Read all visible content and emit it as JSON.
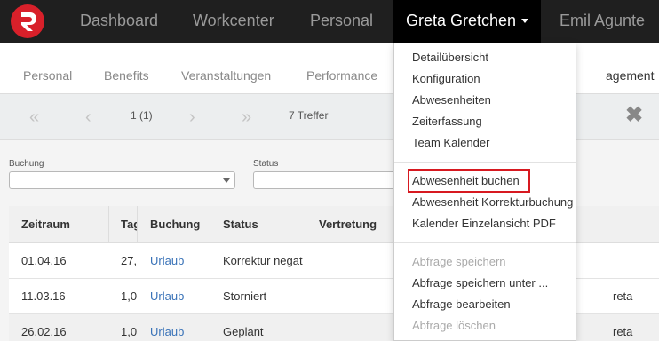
{
  "topnav": {
    "items": [
      "Dashboard",
      "Workcenter",
      "Personal"
    ],
    "active": "Greta Gretchen",
    "overflow": "Emil Agunte"
  },
  "subnav": {
    "items": [
      "Personal",
      "Benefits",
      "Veranstaltungen",
      "Performance"
    ],
    "overflow": "agement"
  },
  "pager": {
    "first": "«",
    "prev": "‹",
    "page": "1 (1)",
    "next": "›",
    "last": "»",
    "count": "7 Treffer",
    "close": "✖"
  },
  "filters": {
    "buchung_label": "Buchung",
    "status_label": "Status"
  },
  "table": {
    "headers": [
      "Zeitraum",
      "Tag",
      "Buchung",
      "Status",
      "Vertretung"
    ],
    "rows": [
      {
        "zeitraum": "01.04.16",
        "tage": "27,",
        "buchung": "Urlaub",
        "status": "Korrektur negat",
        "extra": ""
      },
      {
        "zeitraum": "11.03.16",
        "tage": "1,0",
        "buchung": "Urlaub",
        "status": "Storniert",
        "extra": "reta"
      },
      {
        "zeitraum": "26.02.16",
        "tage": "1,0",
        "buchung": "Urlaub",
        "status": "Geplant",
        "extra": "reta"
      }
    ]
  },
  "dropdown": {
    "group1": [
      "Detailübersicht",
      "Konfiguration",
      "Abwesenheiten",
      "Zeiterfassung",
      "Team Kalender"
    ],
    "group2": [
      "Abwesenheit buchen",
      "Abwesenheit Korrekturbuchung",
      "Kalender Einzelansicht PDF"
    ],
    "group3": [
      "Abfrage speichern",
      "Abfrage speichern unter ...",
      "Abfrage bearbeiten",
      "Abfrage löschen"
    ]
  },
  "colors": {
    "brand": "#d8202a",
    "link": "#3a73b8",
    "highlight": "#d71920"
  },
  "icons": {
    "logo": "app-logo-icon",
    "close": "close-icon",
    "caret": "caret-down-icon"
  }
}
